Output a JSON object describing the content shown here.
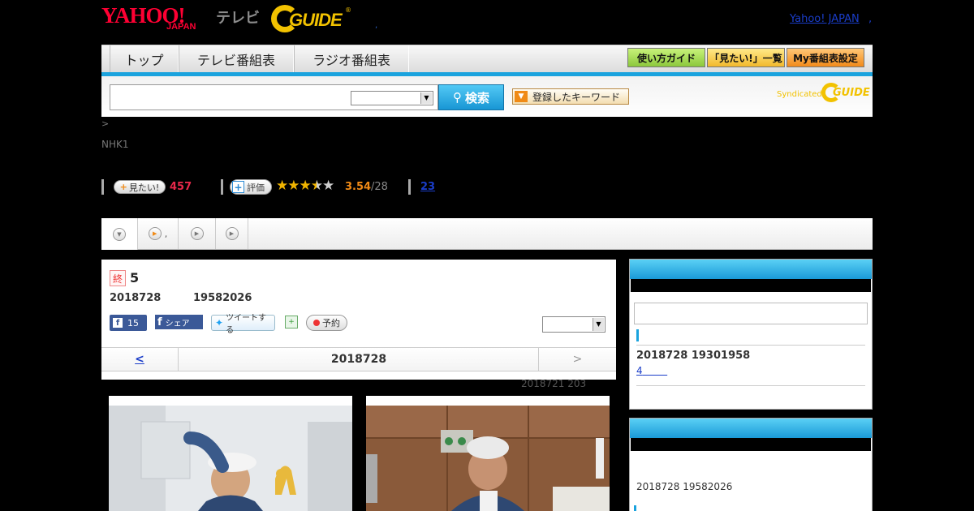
{
  "header": {
    "logo_text": "YAHOO!",
    "logo_sub": "JAPAN",
    "tv_label": "テレビ",
    "gguide_logo": "GUIDE",
    "gguide_reg": "®",
    "dot": ",",
    "yahoo_japan_link": "Yahoo! JAPAN",
    "yahoo_japan_dot": ","
  },
  "nav": {
    "tabs": [
      "トップ",
      "テレビ番組表",
      "ラジオ番組表"
    ],
    "buttons": {
      "guide": "使い方ガイド",
      "mitai_list": "「見たい!」一覧",
      "my_schedule": "My番組表設定"
    },
    "accent_color": "#1aa3de"
  },
  "search": {
    "input_value": "",
    "select_value": "",
    "button_label": "検索",
    "keyword_button": "登録したキーワード",
    "syndicated": "Syndicated",
    "syndicated_logo": "GUIDE"
  },
  "breadcrumb": {
    "sep": ">"
  },
  "program": {
    "channel": "NHK1",
    "mitai_label": "見たい!",
    "mitai_count": "457",
    "hyoka_label": "評価",
    "rating": "3.54",
    "rating_count": "/28",
    "stars": 3.5,
    "review_count": "23"
  },
  "tabs_row": {
    "tab2_label": ","
  },
  "detail": {
    "end_badge": "終",
    "episode": "5",
    "date": "2018728",
    "time": "19582026",
    "fb_like_count": "15",
    "fb_share": "シェア",
    "tweet": "ツイートする",
    "reserve": "予約",
    "nav_prev": "<",
    "nav_date": "2018728",
    "nav_next": ">",
    "update_note": "2018721  203"
  },
  "sidebar": {
    "box1_info": "2018728  19301958",
    "box1_link": "4",
    "box2_info": "2018728  19582026"
  },
  "icons": {
    "search": "search-icon",
    "reserve": "record-dot-icon",
    "calendar": "calendar-add-icon",
    "facebook": "facebook-icon",
    "twitter": "twitter-bird-icon"
  }
}
